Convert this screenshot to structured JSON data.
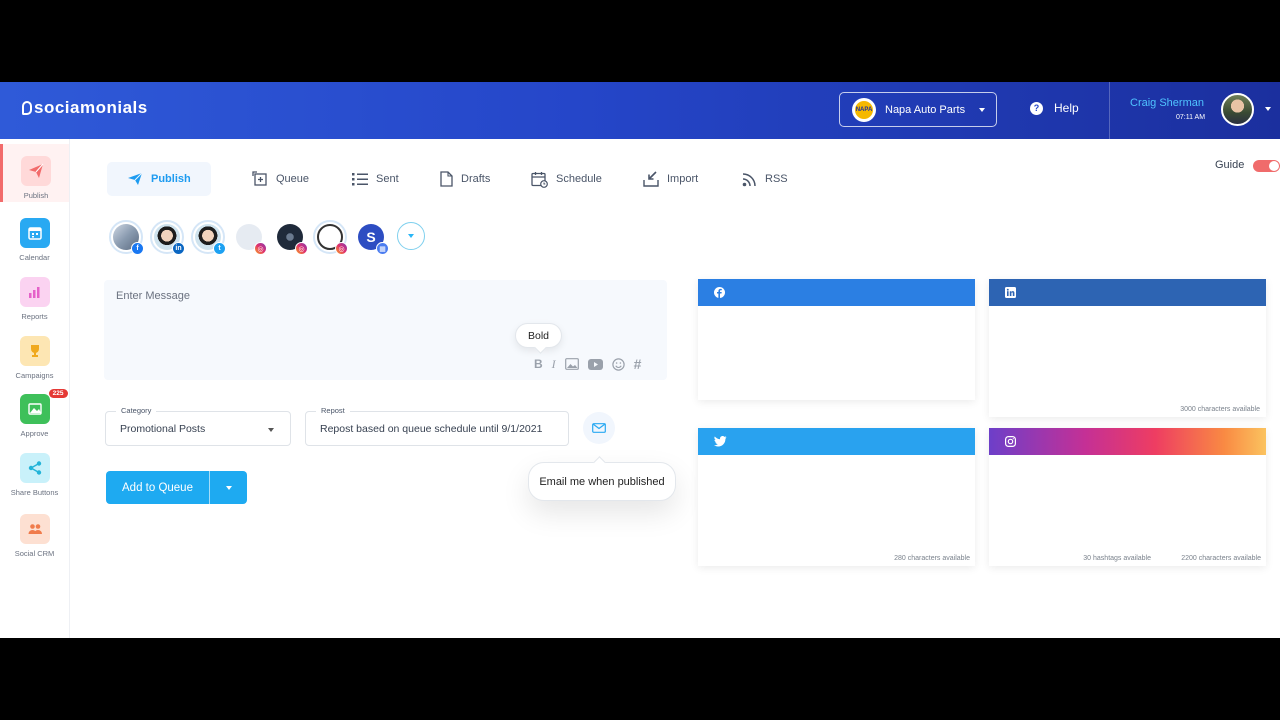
{
  "app": {
    "logo": "sociamonials"
  },
  "header": {
    "brand": {
      "name": "Napa Auto Parts",
      "logo_text": "NAPA"
    },
    "help_label": "Help",
    "user": {
      "name": "Craig Sherman",
      "time": "07:11 AM"
    }
  },
  "sidebar": {
    "items": [
      {
        "label": "Publish",
        "icon": "paper-plane-icon",
        "color": "#f26b6b"
      },
      {
        "label": "Calendar",
        "icon": "calendar-icon",
        "color": "#29a9f2"
      },
      {
        "label": "Reports",
        "icon": "bar-chart-icon",
        "color": "#e561c9"
      },
      {
        "label": "Campaigns",
        "icon": "trophy-icon",
        "color": "#f0a91e"
      },
      {
        "label": "Approve",
        "icon": "image-check-icon",
        "color": "#3ec05a",
        "badge": "225"
      },
      {
        "label": "Share Buttons",
        "icon": "share-icon",
        "color": "#23b4d8"
      },
      {
        "label": "Social CRM",
        "icon": "people-icon",
        "color": "#f07b4b"
      }
    ]
  },
  "tabs": [
    {
      "label": "Publish",
      "icon": "paper-plane-icon"
    },
    {
      "label": "Queue",
      "icon": "queue-add-icon"
    },
    {
      "label": "Sent",
      "icon": "list-icon"
    },
    {
      "label": "Drafts",
      "icon": "document-icon"
    },
    {
      "label": "Schedule",
      "icon": "calendar-clock-icon"
    },
    {
      "label": "Import",
      "icon": "import-icon"
    },
    {
      "label": "RSS",
      "icon": "rss-icon"
    }
  ],
  "guide": {
    "label": "Guide",
    "enabled": true
  },
  "accounts": [
    {
      "network": "facebook",
      "icon": "facebook-icon"
    },
    {
      "network": "linkedin",
      "icon": "linkedin-icon"
    },
    {
      "network": "twitter",
      "icon": "twitter-icon"
    },
    {
      "network": "instagram",
      "icon": "instagram-icon"
    },
    {
      "network": "instagram",
      "icon": "instagram-icon"
    },
    {
      "network": "instagram",
      "icon": "instagram-icon"
    },
    {
      "network": "google-my-business",
      "icon": "gmb-icon"
    }
  ],
  "composer": {
    "placeholder": "Enter Message",
    "tooltip": "Bold",
    "tools": [
      "bold-icon",
      "italic-icon",
      "image-icon",
      "youtube-icon",
      "emoji-icon",
      "hashtag-icon"
    ]
  },
  "category": {
    "label": "Category",
    "value": "Promotional Posts"
  },
  "repost": {
    "label": "Repost",
    "value": "Repost based on queue schedule until 9/1/2021"
  },
  "email_tooltip": "Email me when published",
  "add_to_queue_label": "Add to Queue",
  "previews": {
    "facebook": {
      "color": "#2b7fe3",
      "icon": "facebook-icon"
    },
    "linkedin": {
      "color": "#2d64b3",
      "icon": "linkedin-icon",
      "chars": "3000 characters available"
    },
    "twitter": {
      "color": "#29a2ef",
      "icon": "twitter-icon",
      "chars": "280 characters available"
    },
    "instagram": {
      "icon": "instagram-icon",
      "hashtags": "30 hashtags available",
      "chars": "2200 characters available"
    }
  }
}
